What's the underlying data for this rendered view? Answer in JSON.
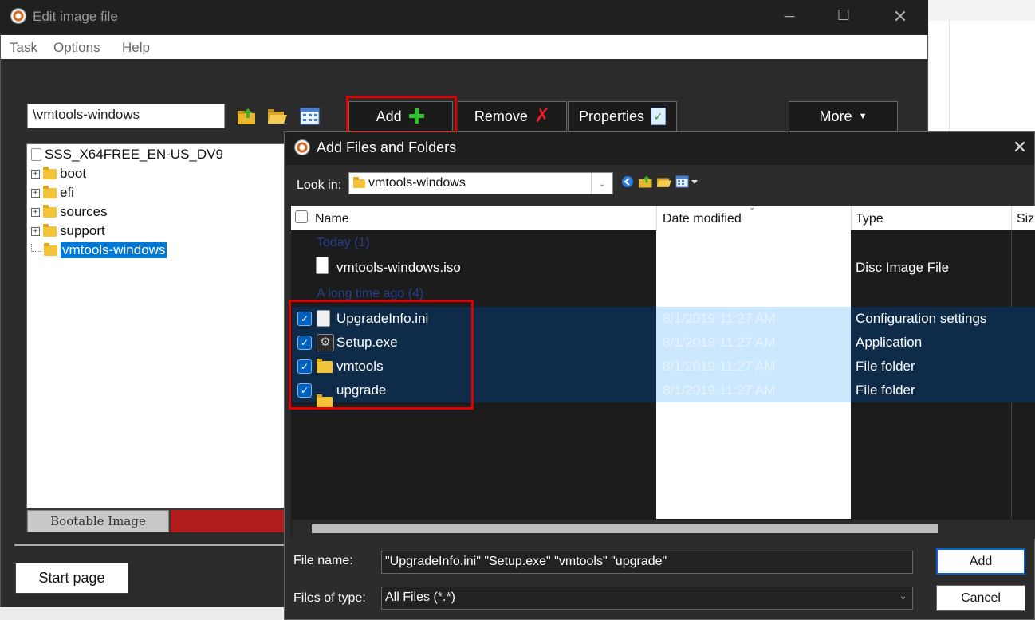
{
  "main_window": {
    "title": "Edit image file",
    "menu": [
      "Task",
      "Options",
      "Help"
    ],
    "path_value": "\\vmtools-windows",
    "buttons": {
      "add": "Add",
      "remove": "Remove",
      "properties": "Properties",
      "more": "More"
    },
    "tree": {
      "root": "SSS_X64FREE_EN-US_DV9",
      "items": [
        "boot",
        "efi",
        "sources",
        "support",
        "vmtools-windows"
      ],
      "selected": "vmtools-windows"
    },
    "tab_bootable": "Bootable Image",
    "start_page": "Start page"
  },
  "dialog": {
    "title": "Add Files and Folders",
    "look_in_label": "Look in:",
    "look_in_value": "vmtools-windows",
    "columns": [
      "Name",
      "Date modified",
      "Type",
      "Siz"
    ],
    "groups": {
      "today": "Today (1)",
      "older": "A long time ago (4)"
    },
    "iso": {
      "name": "vmtools-windows.iso",
      "date": "",
      "type": "Disc Image File"
    },
    "rows": [
      {
        "name": "UpgradeInfo.ini",
        "date": "8/1/2019 11:27 AM",
        "type": "Configuration settings"
      },
      {
        "name": "Setup.exe",
        "date": "8/1/2019 11:27 AM",
        "type": "Application"
      },
      {
        "name": "vmtools",
        "date": "8/1/2019 11:27 AM",
        "type": "File folder"
      },
      {
        "name": "upgrade",
        "date": "8/1/2019 11:27 AM",
        "type": "File folder"
      }
    ],
    "file_name_label": "File name:",
    "file_name_value": "\"UpgradeInfo.ini\" \"Setup.exe\" \"vmtools\" \"upgrade\"",
    "files_of_type_label": "Files of type:",
    "files_of_type_value": "All Files (*.*)",
    "add_button": "Add",
    "cancel_button": "Cancel"
  },
  "colors": {
    "highlight": "#e00000",
    "selection": "#0078d7"
  }
}
